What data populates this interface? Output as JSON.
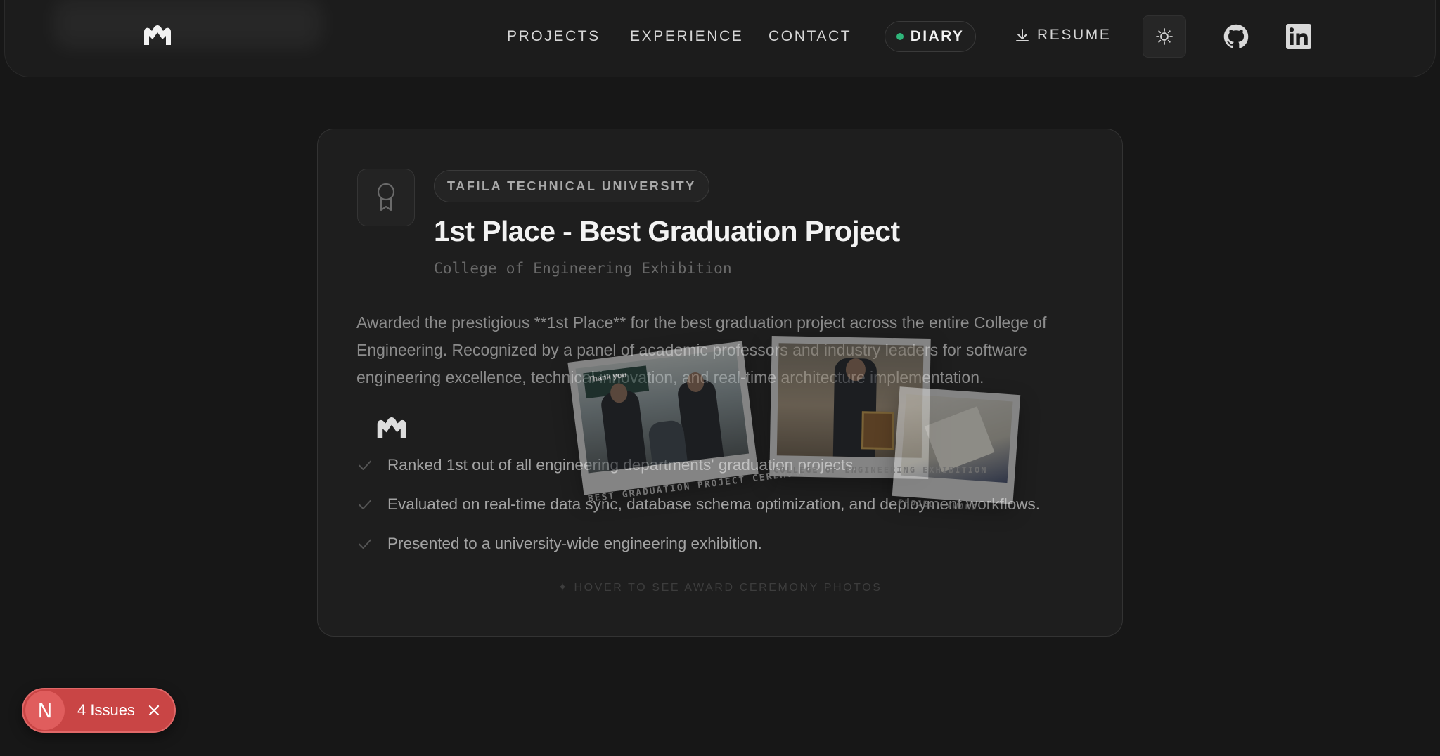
{
  "header": {
    "nav": {
      "projects": "PROJECTS",
      "experience": "EXPERIENCE",
      "contact": "CONTACT",
      "diary": "DIARY",
      "resume": "RESUME"
    },
    "logo_icon": "m-logo-icon",
    "theme_icon": "sun-icon",
    "github_icon": "github-icon",
    "linkedin_icon": "linkedin-icon",
    "diary_dot_color": "#2fb57a"
  },
  "award": {
    "icon": "award-ribbon-icon",
    "institution": "TAFILA TECHNICAL UNIVERSITY",
    "title": "1st Place - Best Graduation Project",
    "subtitle": "College of Engineering Exhibition",
    "description": "Awarded the prestigious **1st Place** for the best graduation project across the entire College of Engineering. Recognized by a panel of academic professors and industry leaders for software engineering excellence, technical innovation, and real-time architecture implementation.",
    "bullets": [
      "Ranked 1st out of all engineering departments' graduation projects.",
      "Evaluated on real-time data sync, database schema optimization, and deployment workflows.",
      "Presented to a university-wide engineering exhibition."
    ],
    "hover_hint": "✦ HOVER TO SEE AWARD CEREMONY PHOTOS"
  },
  "photos": {
    "sign_text": "Thank you",
    "captions": [
      "BEST GRADUATION PROJECT CEREMONY",
      "COLLEGE OF ENGINEERING EXHIBITION",
      "PROJECT AWARD"
    ]
  },
  "issues_toast": {
    "initial": "N",
    "label": "4 Issues",
    "accent": "#c94545"
  }
}
